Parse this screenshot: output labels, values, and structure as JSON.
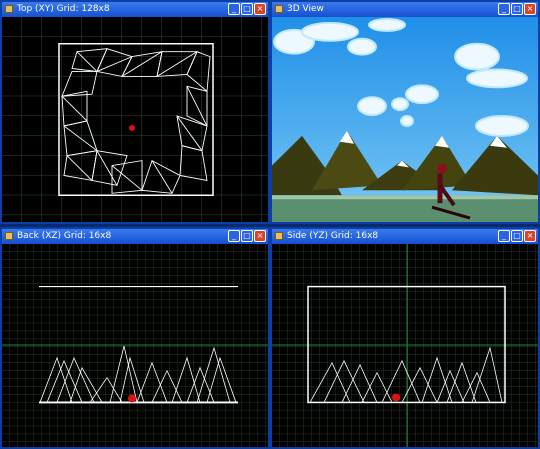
{
  "panes": {
    "top": {
      "title": "Top (XY) Grid: 128x8"
    },
    "view3d": {
      "title": "3D View"
    },
    "back": {
      "title": "Back (XZ) Grid: 16x8"
    },
    "side": {
      "title": "Side (YZ) Grid: 16x8"
    }
  },
  "buttons": {
    "minimize": "_",
    "maximize": "□",
    "close": "×"
  },
  "colors": {
    "titlebar": "#1550d0",
    "grid": "#2f4a2f",
    "axis": "#1a8a2a",
    "wire": "#ffffff",
    "marker": "#e01010"
  }
}
